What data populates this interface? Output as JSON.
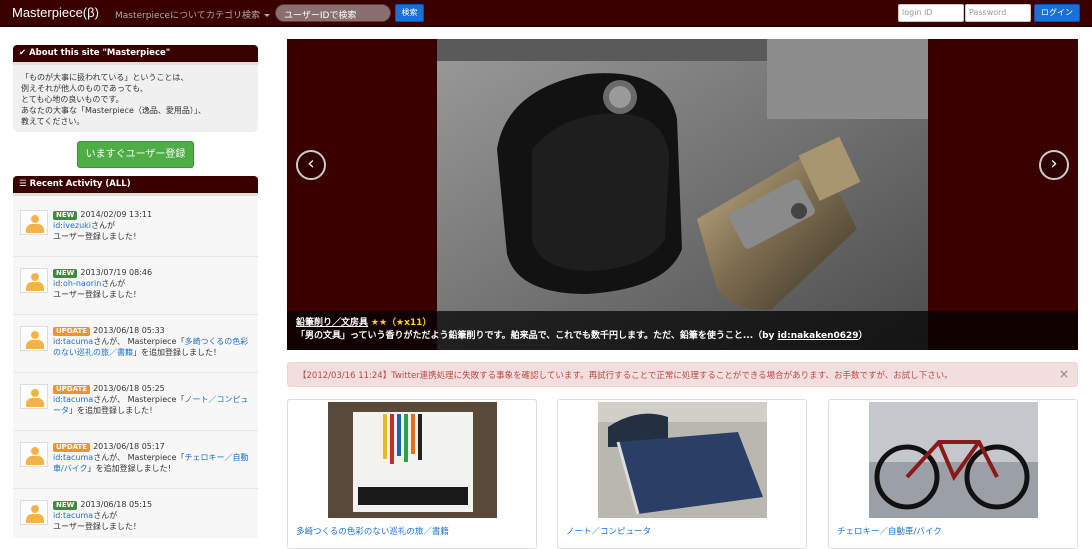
{
  "nav": {
    "brand": "Masterpiece(β)",
    "about": "Masterpieceについて",
    "category": "カテゴリ検索",
    "search_placeholder": "ユーザーIDで検索",
    "search_button": "検索",
    "login_id_placeholder": "login ID",
    "password_placeholder": "Password",
    "login_button": "ログイン"
  },
  "about_box": {
    "title": "About this site \"Masterpiece\"",
    "lines": [
      "「ものが大事に扱われている」ということは、",
      "例えそれが他人のものであっても、",
      "とても心地の良いものです。",
      "あなたの大事な「Masterpiece（逸品、愛用品）」、",
      "教えてください。"
    ]
  },
  "register_button": "いますぐユーザー登録",
  "activity": {
    "title": "Recent Activity (ALL)",
    "items": [
      {
        "badge": "NEW",
        "date": "2014/02/09 13:11",
        "user": "id:ivezuki",
        "suffix": "さんが",
        "text": "ユーザー登録しました！"
      },
      {
        "badge": "NEW",
        "date": "2013/07/19 08:46",
        "user": "id:oh-naorin",
        "suffix": "さんが",
        "text": "ユーザー登録しました！"
      },
      {
        "badge": "UPDATE",
        "date": "2013/06/18 05:33",
        "user": "id:tacuma",
        "suffix": "さんが、 Masterpiece「",
        "link": "多崎つくるの色彩のない巡礼の旅／書籍",
        "text": "」を追加登録しました！"
      },
      {
        "badge": "UPDATE",
        "date": "2013/06/18 05:25",
        "user": "id:tacuma",
        "suffix": "さんが、 Masterpiece「",
        "link": "ノート／コンピュータ",
        "text": "」を追加登録しました！"
      },
      {
        "badge": "UPDATE",
        "date": "2013/06/18 05:17",
        "user": "id:tacuma",
        "suffix": "さんが、 Masterpiece「",
        "link": "チェロキー／自動車/バイク",
        "text": "」を追加登録しました！"
      },
      {
        "badge": "NEW",
        "date": "2013/06/18 05:15",
        "user": "id:tacuma",
        "suffix": "さんが",
        "text": "ユーザー登録しました！"
      }
    ]
  },
  "carousel": {
    "title": "鉛筆削り／文房具",
    "stars": "★★",
    "count": "（★x11）",
    "description": "「男の文具」っていう香りがただよう鉛筆削りです。舶来品で、これでも数千円します。ただ、鉛筆を使うこと...（by ",
    "by_user": "id:nakaken0629",
    "close_paren": "）"
  },
  "alert": {
    "strong": "【2012/03/16 11:24】Twitter連携処理に失敗する事象を確認しています。",
    "text": "再試行することで正常に処理することができる場合があります、お手数ですが、お試し下さい。",
    "close": "×"
  },
  "thumbs": [
    {
      "label": "多崎つくるの色彩のない巡礼の旅／書籍"
    },
    {
      "label": "ノート／コンピュータ"
    },
    {
      "label": "チェロキー／自動車/バイク"
    }
  ]
}
